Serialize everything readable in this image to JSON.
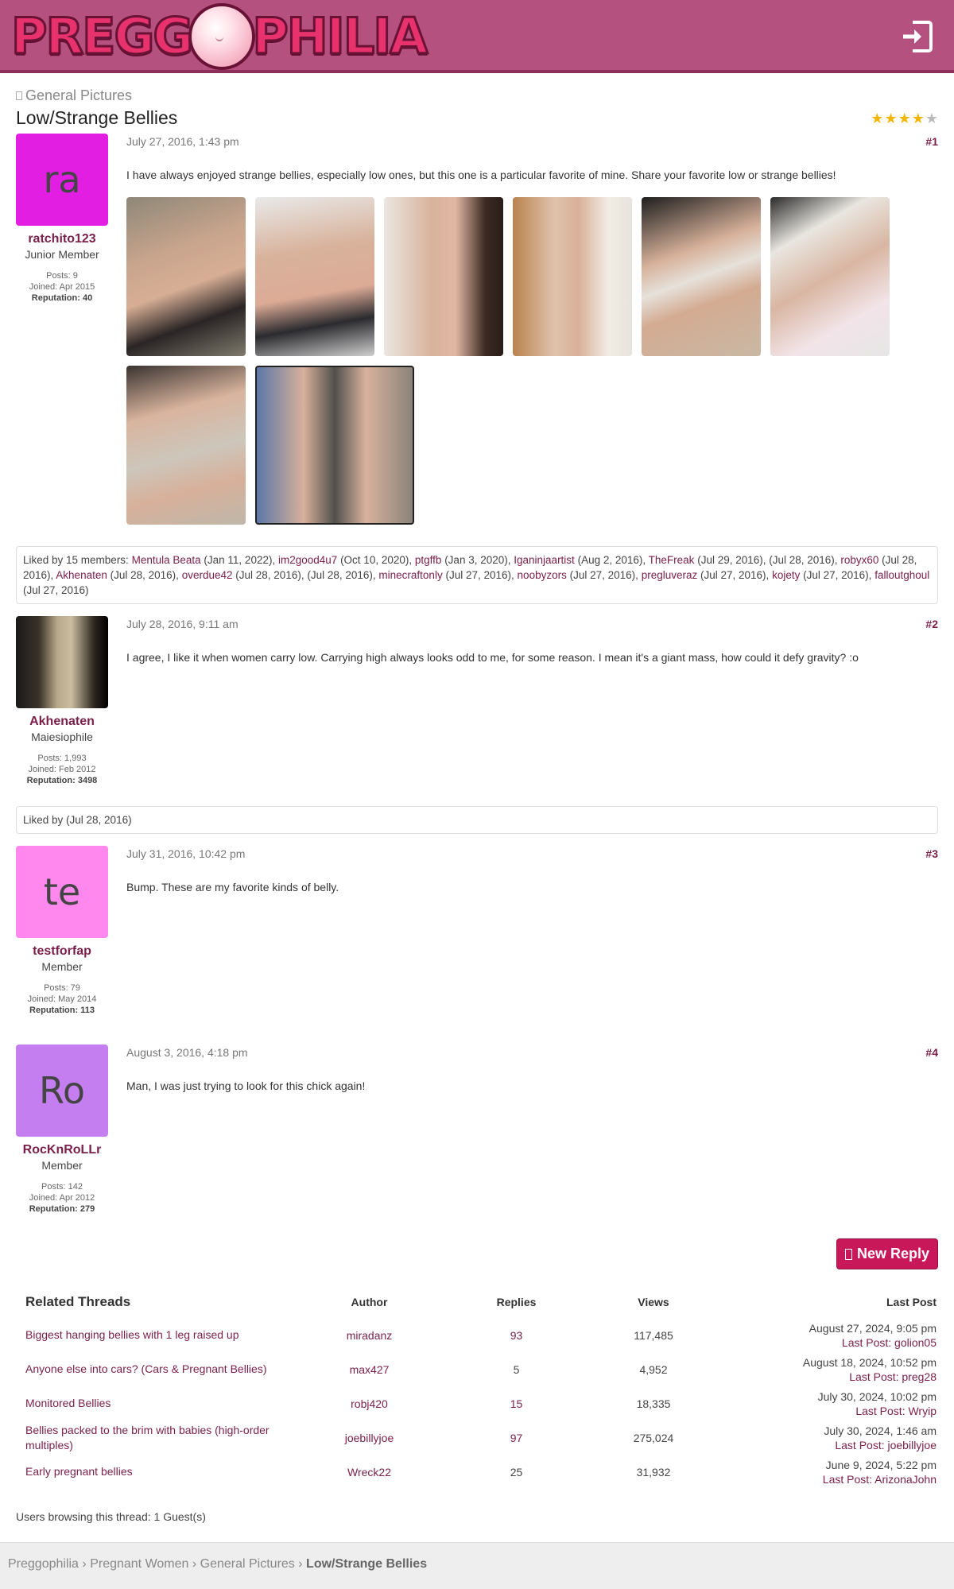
{
  "header": {
    "logo_text_left": "PREGG",
    "logo_text_right": "PHILIA",
    "login_icon": "sign-in-icon"
  },
  "breadcrumb_top": {
    "label": "General Pictures",
    "icon": "folder-icon"
  },
  "thread": {
    "title": "Low/Strange Bellies",
    "rating_stars": 4,
    "rating_max": 5
  },
  "posts": [
    {
      "avatar_initials": "ra",
      "avatar_color": "#e11ee1",
      "username": "ratchito123",
      "user_title": "Junior Member",
      "posts": "Posts: 9",
      "joined": "Joined: Apr 2015",
      "reputation": "Reputation: 40",
      "date": "July 27, 2016, 1:43 pm",
      "number": "#1",
      "text": "I have always enjoyed strange bellies, especially low ones, but this one is a particular favorite of mine. Share your favorite low or strange bellies!"
    },
    {
      "avatar_initials": "",
      "avatar_color": "#000000",
      "username": "Akhenaten",
      "user_title": "Maiesiophile",
      "posts": "Posts: 1,993",
      "joined": "Joined: Feb 2012",
      "reputation": "Reputation: 3498",
      "date": "July 28, 2016, 9:11 am",
      "number": "#2",
      "text": "I agree, I like it when women carry low. Carrying high always looks odd to me, for some reason. I mean it's a giant mass, how could it defy gravity? :o"
    },
    {
      "avatar_initials": "te",
      "avatar_color": "#ff88ee",
      "username": "testforfap",
      "user_title": "Member",
      "posts": "Posts: 79",
      "joined": "Joined: May 2014",
      "reputation": "Reputation: 113",
      "date": "July 31, 2016, 10:42 pm",
      "number": "#3",
      "text": "Bump. These are my favorite kinds of belly."
    },
    {
      "avatar_initials": "Ro",
      "avatar_color": "#c47ef0",
      "username": "RocKnRoLLr",
      "user_title": "Member",
      "posts": "Posts: 142",
      "joined": "Joined: Apr 2012",
      "reputation": "Reputation: 279",
      "date": "August 3, 2016, 4:18 pm",
      "number": "#4",
      "text": "Man, I was just trying to look for this chick again!"
    }
  ],
  "likes_1": {
    "prefix": "Liked by 15 members:",
    "entries": [
      {
        "name": "Mentula Beata",
        "date": "(Jan 11, 2022),"
      },
      {
        "name": "im2good4u7",
        "date": "(Oct 10, 2020),"
      },
      {
        "name": "ptgffb",
        "date": "(Jan 3, 2020),"
      },
      {
        "name": "Iganinjaartist",
        "date": "(Aug 2, 2016),"
      },
      {
        "name": "TheFreak",
        "date": "(Jul 29, 2016), (Jul 28, 2016),"
      },
      {
        "name": "robyx60",
        "date": "(Jul 28, 2016),"
      },
      {
        "name": "Akhenaten",
        "date": "(Jul 28, 2016),"
      },
      {
        "name": "overdue42",
        "date": "(Jul 28, 2016), (Jul 28, 2016),"
      },
      {
        "name": "minecraftonly",
        "date": "(Jul 27, 2016),"
      },
      {
        "name": "noobyzors",
        "date": "(Jul 27, 2016),"
      },
      {
        "name": "pregluveraz",
        "date": "(Jul 27, 2016),"
      },
      {
        "name": "kojety",
        "date": "(Jul 27, 2016),"
      },
      {
        "name": "falloutghoul",
        "date": "(Jul 27, 2016)"
      }
    ]
  },
  "likes_2": {
    "text": "Liked by (Jul 28, 2016)"
  },
  "new_reply_label": "New Reply",
  "related": {
    "headers": {
      "title": "Related Threads",
      "author": "Author",
      "replies": "Replies",
      "views": "Views",
      "last": "Last Post"
    },
    "rows": [
      {
        "title": "Biggest hanging bellies with 1 leg raised up",
        "author": "miradanz",
        "replies": "93",
        "views": "117,485",
        "date": "August 27, 2024, 9:05 pm",
        "last": "Last Post: golion05"
      },
      {
        "title": "Anyone else into cars? (Cars & Pregnant Bellies)",
        "author": "max427",
        "replies": "5",
        "views": "4,952",
        "date": "August 18, 2024, 10:52 pm",
        "last": "Last Post: preg28"
      },
      {
        "title": "Monitored Bellies",
        "author": "robj420",
        "replies": "15",
        "views": "18,335",
        "date": "July 30, 2024, 10:02 pm",
        "last": "Last Post: Wryip"
      },
      {
        "title": "Bellies packed to the brim with babies (high-order multiples)",
        "author": "joebillyjoe",
        "replies": "97",
        "views": "275,024",
        "date": "July 30, 2024, 1:46 am",
        "last": "Last Post: joebillyjoe"
      },
      {
        "title": "Early pregnant bellies",
        "author": "Wreck22",
        "replies": "25",
        "views": "31,932",
        "date": "June 9, 2024, 5:22 pm",
        "last": "Last Post: ArizonaJohn"
      }
    ]
  },
  "browsing": "Users browsing this thread: 1 Guest(s)",
  "footer": {
    "c1": "Preggophilia",
    "c2": "Pregnant Women",
    "c3": "General Pictures",
    "current": "Low/Strange Bellies",
    "sep": "›"
  }
}
